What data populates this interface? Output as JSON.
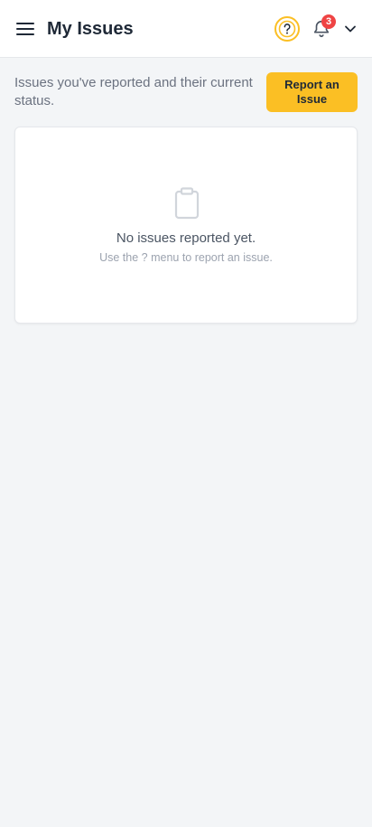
{
  "header": {
    "title": "My Issues",
    "notification_count": "3"
  },
  "intro": {
    "text": "Issues you've reported and their current status.",
    "report_button_label": "Report an Issue"
  },
  "empty_state": {
    "title": "No issues reported yet.",
    "subtitle": "Use the ? menu to report an issue."
  },
  "colors": {
    "accent": "#fbbf24",
    "badge": "#ef4444",
    "background": "#f3f5f7"
  },
  "icons": [
    "hamburger-menu-icon",
    "help-circle-icon",
    "bell-icon",
    "chevron-down-icon",
    "clipboard-icon"
  ]
}
